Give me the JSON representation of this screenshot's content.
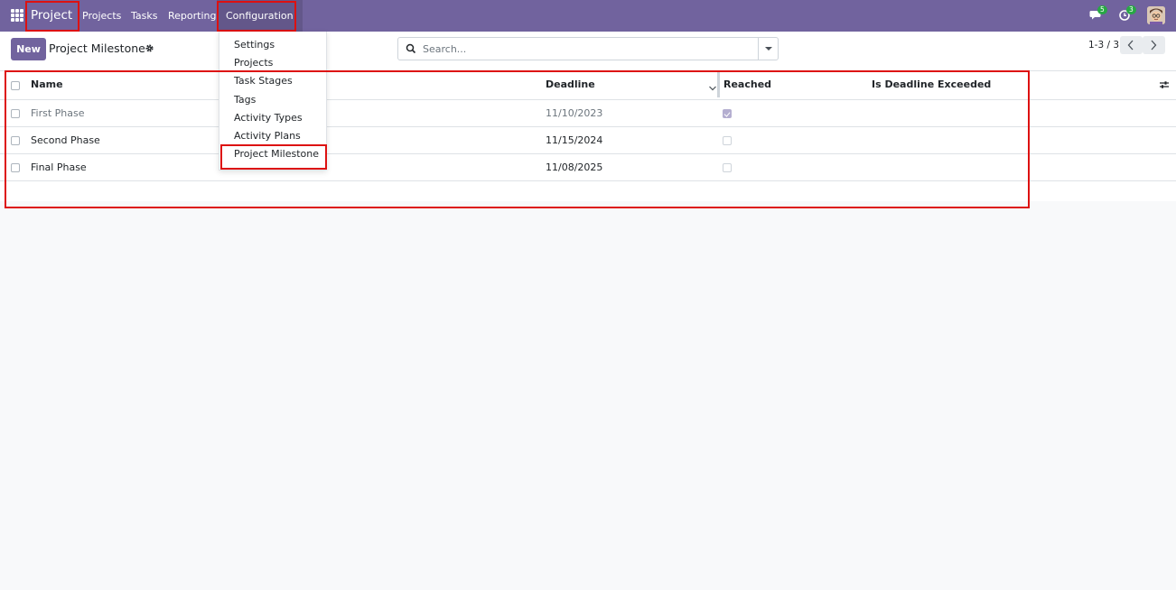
{
  "navbar": {
    "brand": "Project",
    "menu": [
      "Projects",
      "Tasks",
      "Reporting",
      "Configuration"
    ],
    "messages_count": "5",
    "activities_count": "3",
    "color": "#71639e"
  },
  "config_menu": {
    "items": [
      "Settings",
      "Projects",
      "Task Stages",
      "Tags",
      "Activity Types",
      "Activity Plans",
      "Project Milestone"
    ],
    "highlighted": "Project Milestone"
  },
  "control_panel": {
    "new_label": "New",
    "title": "Project Milestone",
    "search_placeholder": "Search...",
    "pager": "1-3 / 3"
  },
  "list": {
    "columns": [
      "Name",
      "Deadline",
      "Reached",
      "Is Deadline Exceeded"
    ],
    "rows": [
      {
        "name": "First Phase",
        "deadline": "11/10/2023",
        "reached": true
      },
      {
        "name": "Second Phase",
        "deadline": "11/15/2024",
        "reached": false
      },
      {
        "name": "Final Phase",
        "deadline": "11/08/2025",
        "reached": false
      }
    ]
  },
  "annotation_color": "#dd1111"
}
